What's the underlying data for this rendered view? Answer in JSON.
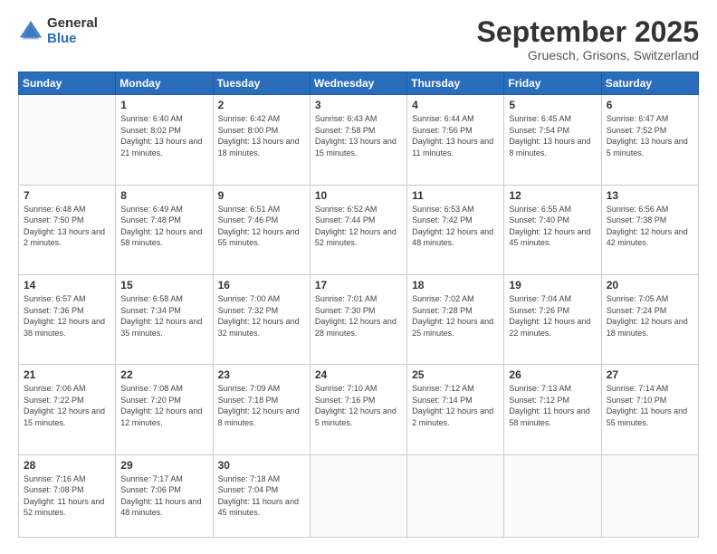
{
  "header": {
    "logo_general": "General",
    "logo_blue": "Blue",
    "month_title": "September 2025",
    "subtitle": "Gruesch, Grisons, Switzerland"
  },
  "days_of_week": [
    "Sunday",
    "Monday",
    "Tuesday",
    "Wednesday",
    "Thursday",
    "Friday",
    "Saturday"
  ],
  "weeks": [
    [
      {
        "num": "",
        "sunrise": "",
        "sunset": "",
        "daylight": ""
      },
      {
        "num": "1",
        "sunrise": "Sunrise: 6:40 AM",
        "sunset": "Sunset: 8:02 PM",
        "daylight": "Daylight: 13 hours and 21 minutes."
      },
      {
        "num": "2",
        "sunrise": "Sunrise: 6:42 AM",
        "sunset": "Sunset: 8:00 PM",
        "daylight": "Daylight: 13 hours and 18 minutes."
      },
      {
        "num": "3",
        "sunrise": "Sunrise: 6:43 AM",
        "sunset": "Sunset: 7:58 PM",
        "daylight": "Daylight: 13 hours and 15 minutes."
      },
      {
        "num": "4",
        "sunrise": "Sunrise: 6:44 AM",
        "sunset": "Sunset: 7:56 PM",
        "daylight": "Daylight: 13 hours and 11 minutes."
      },
      {
        "num": "5",
        "sunrise": "Sunrise: 6:45 AM",
        "sunset": "Sunset: 7:54 PM",
        "daylight": "Daylight: 13 hours and 8 minutes."
      },
      {
        "num": "6",
        "sunrise": "Sunrise: 6:47 AM",
        "sunset": "Sunset: 7:52 PM",
        "daylight": "Daylight: 13 hours and 5 minutes."
      }
    ],
    [
      {
        "num": "7",
        "sunrise": "Sunrise: 6:48 AM",
        "sunset": "Sunset: 7:50 PM",
        "daylight": "Daylight: 13 hours and 2 minutes."
      },
      {
        "num": "8",
        "sunrise": "Sunrise: 6:49 AM",
        "sunset": "Sunset: 7:48 PM",
        "daylight": "Daylight: 12 hours and 58 minutes."
      },
      {
        "num": "9",
        "sunrise": "Sunrise: 6:51 AM",
        "sunset": "Sunset: 7:46 PM",
        "daylight": "Daylight: 12 hours and 55 minutes."
      },
      {
        "num": "10",
        "sunrise": "Sunrise: 6:52 AM",
        "sunset": "Sunset: 7:44 PM",
        "daylight": "Daylight: 12 hours and 52 minutes."
      },
      {
        "num": "11",
        "sunrise": "Sunrise: 6:53 AM",
        "sunset": "Sunset: 7:42 PM",
        "daylight": "Daylight: 12 hours and 48 minutes."
      },
      {
        "num": "12",
        "sunrise": "Sunrise: 6:55 AM",
        "sunset": "Sunset: 7:40 PM",
        "daylight": "Daylight: 12 hours and 45 minutes."
      },
      {
        "num": "13",
        "sunrise": "Sunrise: 6:56 AM",
        "sunset": "Sunset: 7:38 PM",
        "daylight": "Daylight: 12 hours and 42 minutes."
      }
    ],
    [
      {
        "num": "14",
        "sunrise": "Sunrise: 6:57 AM",
        "sunset": "Sunset: 7:36 PM",
        "daylight": "Daylight: 12 hours and 38 minutes."
      },
      {
        "num": "15",
        "sunrise": "Sunrise: 6:58 AM",
        "sunset": "Sunset: 7:34 PM",
        "daylight": "Daylight: 12 hours and 35 minutes."
      },
      {
        "num": "16",
        "sunrise": "Sunrise: 7:00 AM",
        "sunset": "Sunset: 7:32 PM",
        "daylight": "Daylight: 12 hours and 32 minutes."
      },
      {
        "num": "17",
        "sunrise": "Sunrise: 7:01 AM",
        "sunset": "Sunset: 7:30 PM",
        "daylight": "Daylight: 12 hours and 28 minutes."
      },
      {
        "num": "18",
        "sunrise": "Sunrise: 7:02 AM",
        "sunset": "Sunset: 7:28 PM",
        "daylight": "Daylight: 12 hours and 25 minutes."
      },
      {
        "num": "19",
        "sunrise": "Sunrise: 7:04 AM",
        "sunset": "Sunset: 7:26 PM",
        "daylight": "Daylight: 12 hours and 22 minutes."
      },
      {
        "num": "20",
        "sunrise": "Sunrise: 7:05 AM",
        "sunset": "Sunset: 7:24 PM",
        "daylight": "Daylight: 12 hours and 18 minutes."
      }
    ],
    [
      {
        "num": "21",
        "sunrise": "Sunrise: 7:06 AM",
        "sunset": "Sunset: 7:22 PM",
        "daylight": "Daylight: 12 hours and 15 minutes."
      },
      {
        "num": "22",
        "sunrise": "Sunrise: 7:08 AM",
        "sunset": "Sunset: 7:20 PM",
        "daylight": "Daylight: 12 hours and 12 minutes."
      },
      {
        "num": "23",
        "sunrise": "Sunrise: 7:09 AM",
        "sunset": "Sunset: 7:18 PM",
        "daylight": "Daylight: 12 hours and 8 minutes."
      },
      {
        "num": "24",
        "sunrise": "Sunrise: 7:10 AM",
        "sunset": "Sunset: 7:16 PM",
        "daylight": "Daylight: 12 hours and 5 minutes."
      },
      {
        "num": "25",
        "sunrise": "Sunrise: 7:12 AM",
        "sunset": "Sunset: 7:14 PM",
        "daylight": "Daylight: 12 hours and 2 minutes."
      },
      {
        "num": "26",
        "sunrise": "Sunrise: 7:13 AM",
        "sunset": "Sunset: 7:12 PM",
        "daylight": "Daylight: 11 hours and 58 minutes."
      },
      {
        "num": "27",
        "sunrise": "Sunrise: 7:14 AM",
        "sunset": "Sunset: 7:10 PM",
        "daylight": "Daylight: 11 hours and 55 minutes."
      }
    ],
    [
      {
        "num": "28",
        "sunrise": "Sunrise: 7:16 AM",
        "sunset": "Sunset: 7:08 PM",
        "daylight": "Daylight: 11 hours and 52 minutes."
      },
      {
        "num": "29",
        "sunrise": "Sunrise: 7:17 AM",
        "sunset": "Sunset: 7:06 PM",
        "daylight": "Daylight: 11 hours and 48 minutes."
      },
      {
        "num": "30",
        "sunrise": "Sunrise: 7:18 AM",
        "sunset": "Sunset: 7:04 PM",
        "daylight": "Daylight: 11 hours and 45 minutes."
      },
      {
        "num": "",
        "sunrise": "",
        "sunset": "",
        "daylight": ""
      },
      {
        "num": "",
        "sunrise": "",
        "sunset": "",
        "daylight": ""
      },
      {
        "num": "",
        "sunrise": "",
        "sunset": "",
        "daylight": ""
      },
      {
        "num": "",
        "sunrise": "",
        "sunset": "",
        "daylight": ""
      }
    ]
  ]
}
